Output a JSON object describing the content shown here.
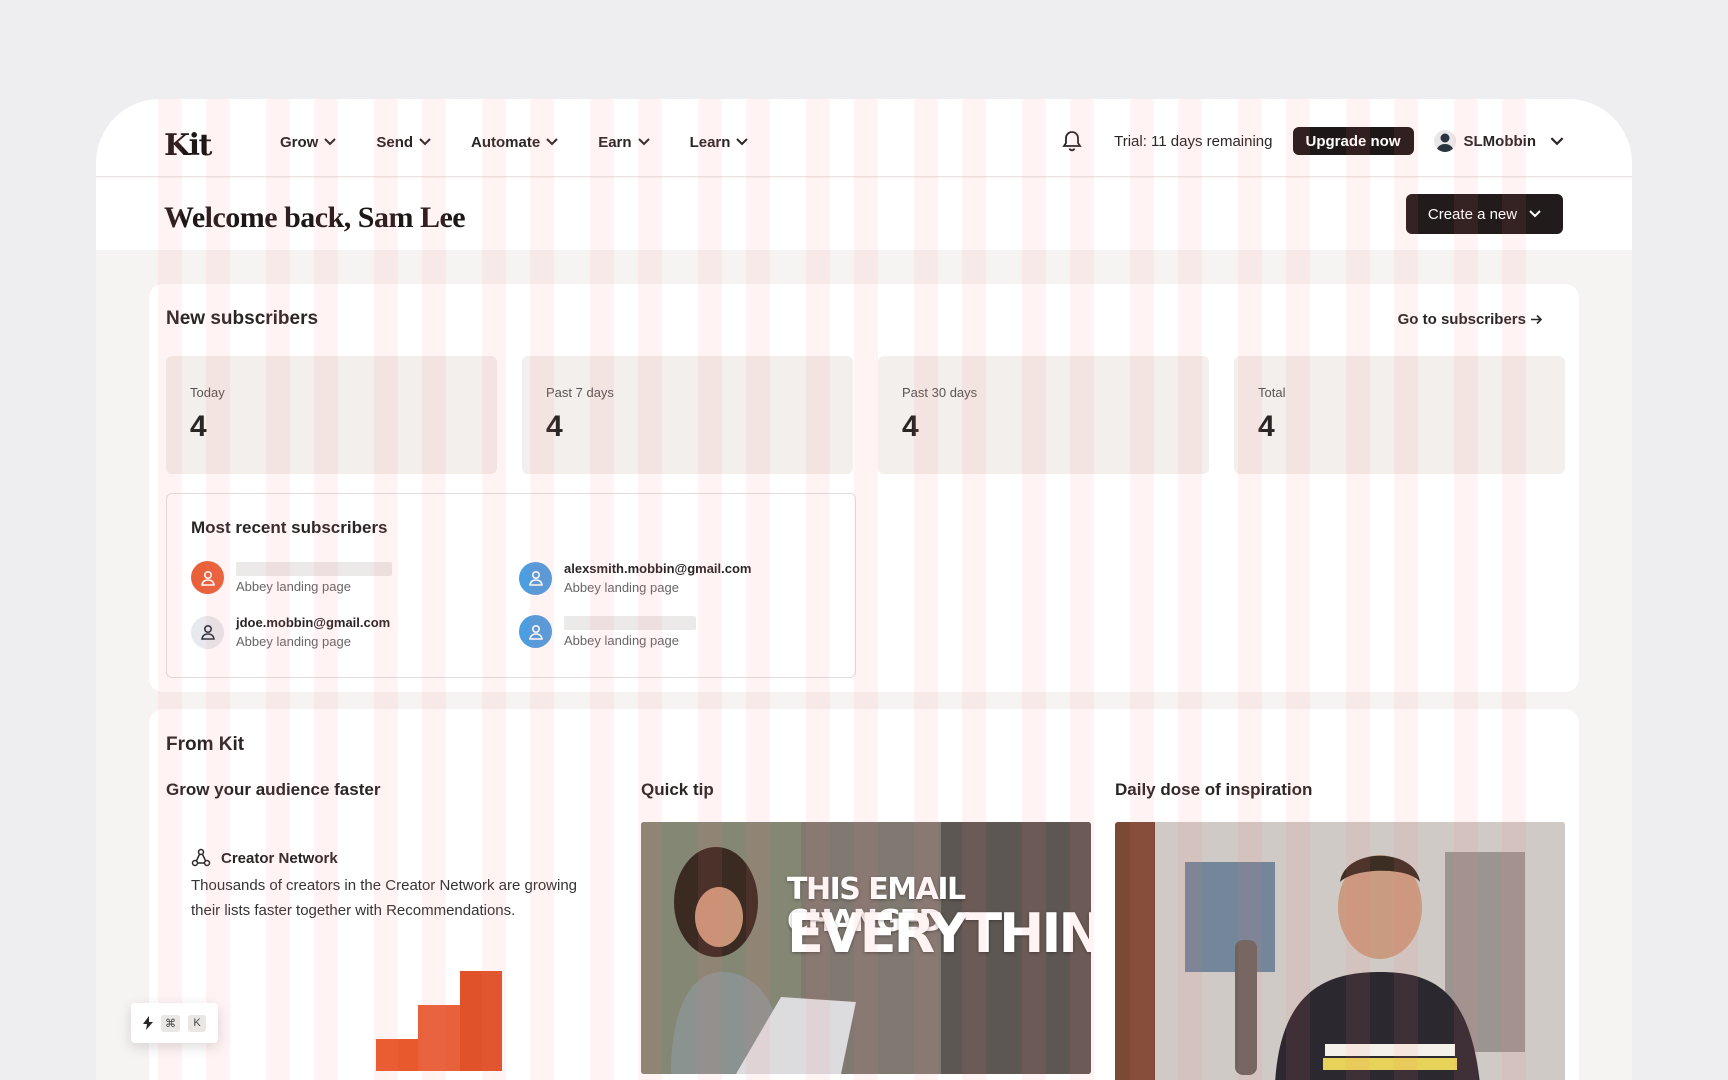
{
  "nav": {
    "logo": "Kit",
    "items": [
      {
        "label": "Grow"
      },
      {
        "label": "Send"
      },
      {
        "label": "Automate"
      },
      {
        "label": "Earn"
      },
      {
        "label": "Learn"
      }
    ],
    "trial_text": "Trial: 11 days remaining",
    "upgrade_label": "Upgrade now",
    "username": "SLMobbin"
  },
  "header": {
    "welcome": "Welcome back, Sam Lee",
    "create_label": "Create a new"
  },
  "subscribers": {
    "title": "New subscribers",
    "go_link": "Go to subscribers",
    "stats": [
      {
        "label": "Today",
        "value": "4"
      },
      {
        "label": "Past 7 days",
        "value": "4"
      },
      {
        "label": "Past 30 days",
        "value": "4"
      },
      {
        "label": "Total",
        "value": "4"
      }
    ],
    "recent": {
      "title": "Most recent subscribers",
      "items": [
        {
          "email": "",
          "source": "Abbey landing page",
          "color": "#e8613a"
        },
        {
          "email": "alexsmith.mobbin@gmail.com",
          "source": "Abbey landing page",
          "color": "#4b9ee0"
        },
        {
          "email": "jdoe.mobbin@gmail.com",
          "source": "Abbey landing page",
          "color": "#e6eaee"
        },
        {
          "email": "",
          "source": "Abbey landing page",
          "color": "#4b9ee0"
        }
      ]
    }
  },
  "from_kit": {
    "title": "From Kit",
    "grow": {
      "title": "Grow your audience faster",
      "network_title": "Creator Network",
      "network_text": "Thousands of creators in the Creator Network are growing their lists faster together with Recommendations."
    },
    "quick_tip": {
      "title": "Quick tip",
      "line1": "THIS EMAIL CHANGED",
      "line2": "EVERYTHING"
    },
    "inspiration": {
      "title": "Daily dose of inspiration"
    }
  },
  "shortcut": {
    "key1": "⌘",
    "key2": "K"
  },
  "colors": {
    "accent": "#e8613a",
    "dark": "#1e1717",
    "blue": "#4b9ee0"
  }
}
